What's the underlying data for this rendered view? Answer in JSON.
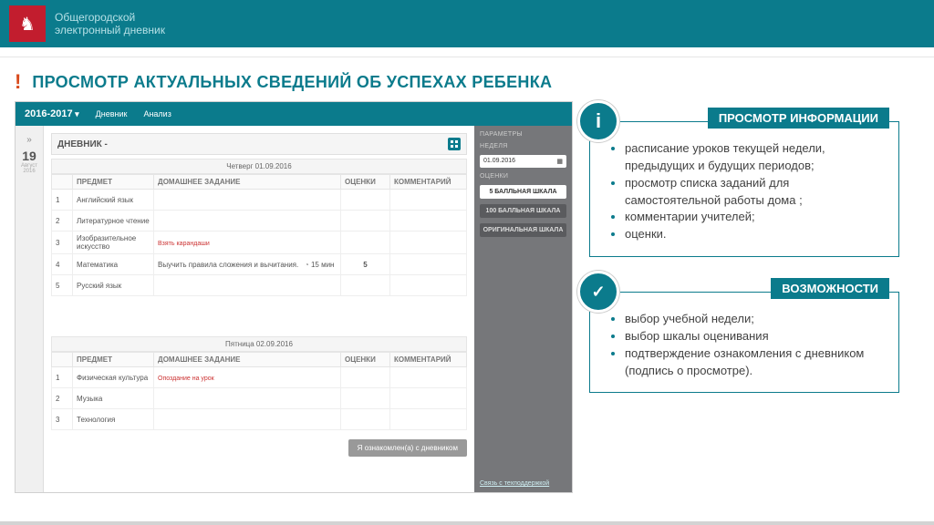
{
  "header": {
    "line1": "Общегородской",
    "line2": "электронный дневник"
  },
  "title": "ПРОСМОТР АКТУАЛЬНЫХ СВЕДЕНИЙ ОБ УСПЕХАХ РЕБЕНКА",
  "app": {
    "year": "2016-2017",
    "tab1": "Дневник",
    "tab2": "Анализ",
    "datecol": {
      "num": "19",
      "mon": "Август",
      "yr": "2016"
    },
    "head": "ДНЕВНИК -",
    "day1": "Четверг  01.09.2016",
    "day2": "Пятница  02.09.2016",
    "cols": {
      "subj": "ПРЕДМЕТ",
      "hw": "ДОМАШНЕЕ ЗАДАНИЕ",
      "mark": "ОЦЕНКИ",
      "comm": "КОММЕНТАРИЙ"
    },
    "rows1": [
      {
        "n": "1",
        "s": "Английский язык"
      },
      {
        "n": "2",
        "s": "Литературное чтение"
      },
      {
        "n": "3",
        "s": "Изобразительное искусство",
        "hw": "Взять карандаши",
        "red": true
      },
      {
        "n": "4",
        "s": "Математика",
        "hw": "Выучить правила сложения и вычитания.",
        "time": "15 мин",
        "mark": "5"
      },
      {
        "n": "5",
        "s": "Русский язык"
      }
    ],
    "rows2": [
      {
        "n": "1",
        "s": "Физическая культура",
        "hw": "Опоздание на урок",
        "red": true
      },
      {
        "n": "2",
        "s": "Музыка"
      },
      {
        "n": "3",
        "s": "Технология"
      }
    ],
    "ack": "Я ознакомлен(а) с дневником",
    "side": {
      "params": "ПАРАМЕТРЫ",
      "week": "Неделя",
      "date": "01.09.2016",
      "marks": "Оценки",
      "sc5": "5 БАЛЛЬНАЯ ШКАЛА",
      "sc100": "100 БАЛЛЬНАЯ ШКАЛА",
      "scO": "ОРИГИНАЛЬНАЯ ШКАЛА",
      "support": "Связь с техподдержкой"
    }
  },
  "info": {
    "title": "ПРОСМОТР ИНФОРМАЦИИ",
    "items": [
      "расписание уроков  текущей недели, предыдущих и будущих периодов;",
      "просмотр списка заданий для самостоятельной работы дома ;",
      "комментарии учителей;",
      "оценки."
    ]
  },
  "feat": {
    "title": "ВОЗМОЖНОСТИ",
    "items": [
      "выбор учебной недели;",
      "выбор шкалы оценивания",
      "подтверждение  ознакомления с дневником (подпись о просмотре)."
    ]
  }
}
